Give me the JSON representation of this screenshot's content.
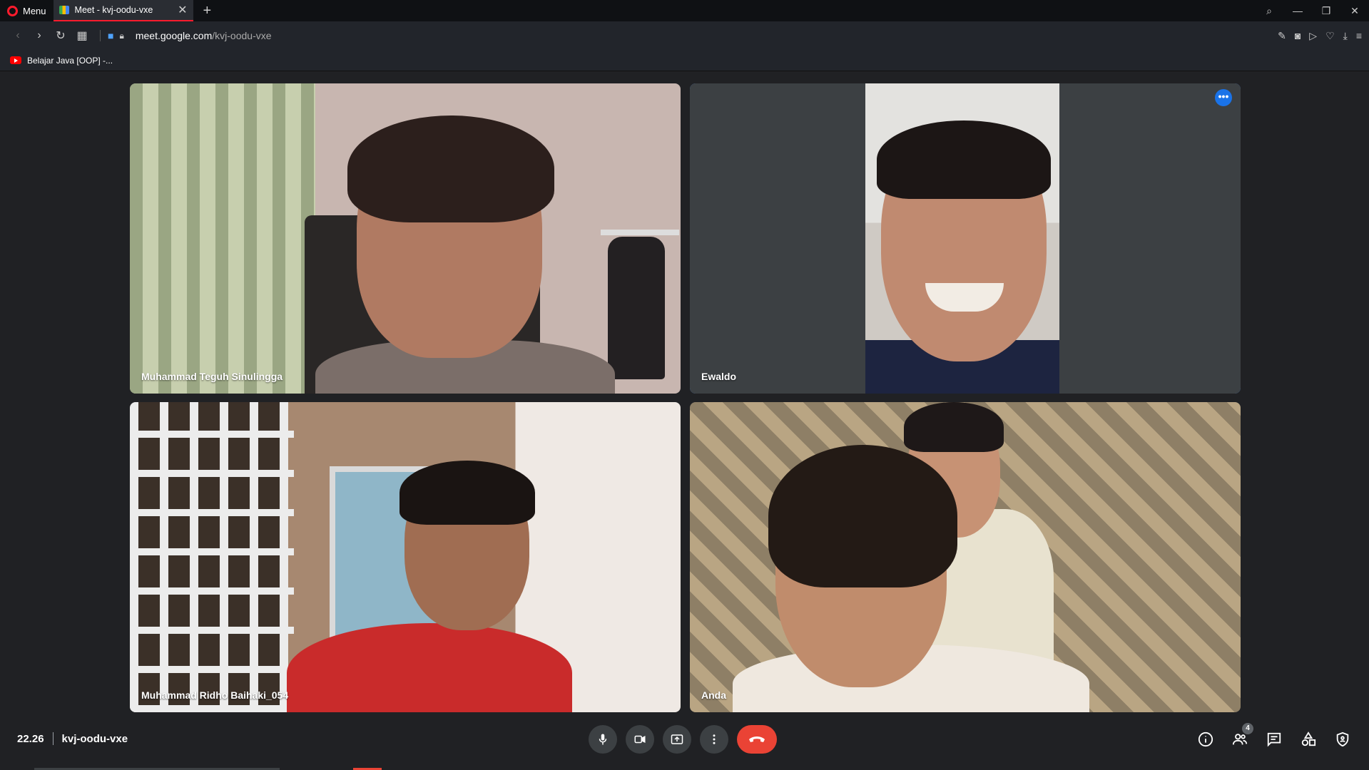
{
  "browser": {
    "menu_label": "Menu",
    "tab_title": "Meet - kvj-oodu-vxe",
    "url_host": "meet.google.com",
    "url_path": "/kvj-oodu-vxe",
    "bookmark_label": "Belajar Java [OOP] -..."
  },
  "participants": [
    {
      "name": "Muhammad Teguh Sinulingga"
    },
    {
      "name": "Ewaldo",
      "active_speaker": true
    },
    {
      "name": "Muhammad Ridho Baihaki_054"
    },
    {
      "name": "Anda"
    }
  ],
  "meeting": {
    "time": "22.26",
    "code": "kvj-oodu-vxe",
    "participant_count": "4"
  },
  "colors": {
    "accent": "#1a73e8",
    "end_call": "#ea4335",
    "background": "#202124",
    "tab_accent": "#ff1b2d"
  },
  "icons": {
    "mic": "mic-icon",
    "camera": "camera-icon",
    "present": "present-icon",
    "more": "more-vert-icon",
    "end_call": "phone-hangup-icon",
    "info": "info-icon",
    "people": "people-icon",
    "chat": "chat-icon",
    "activities": "activities-icon",
    "host_controls": "shield-icon"
  }
}
